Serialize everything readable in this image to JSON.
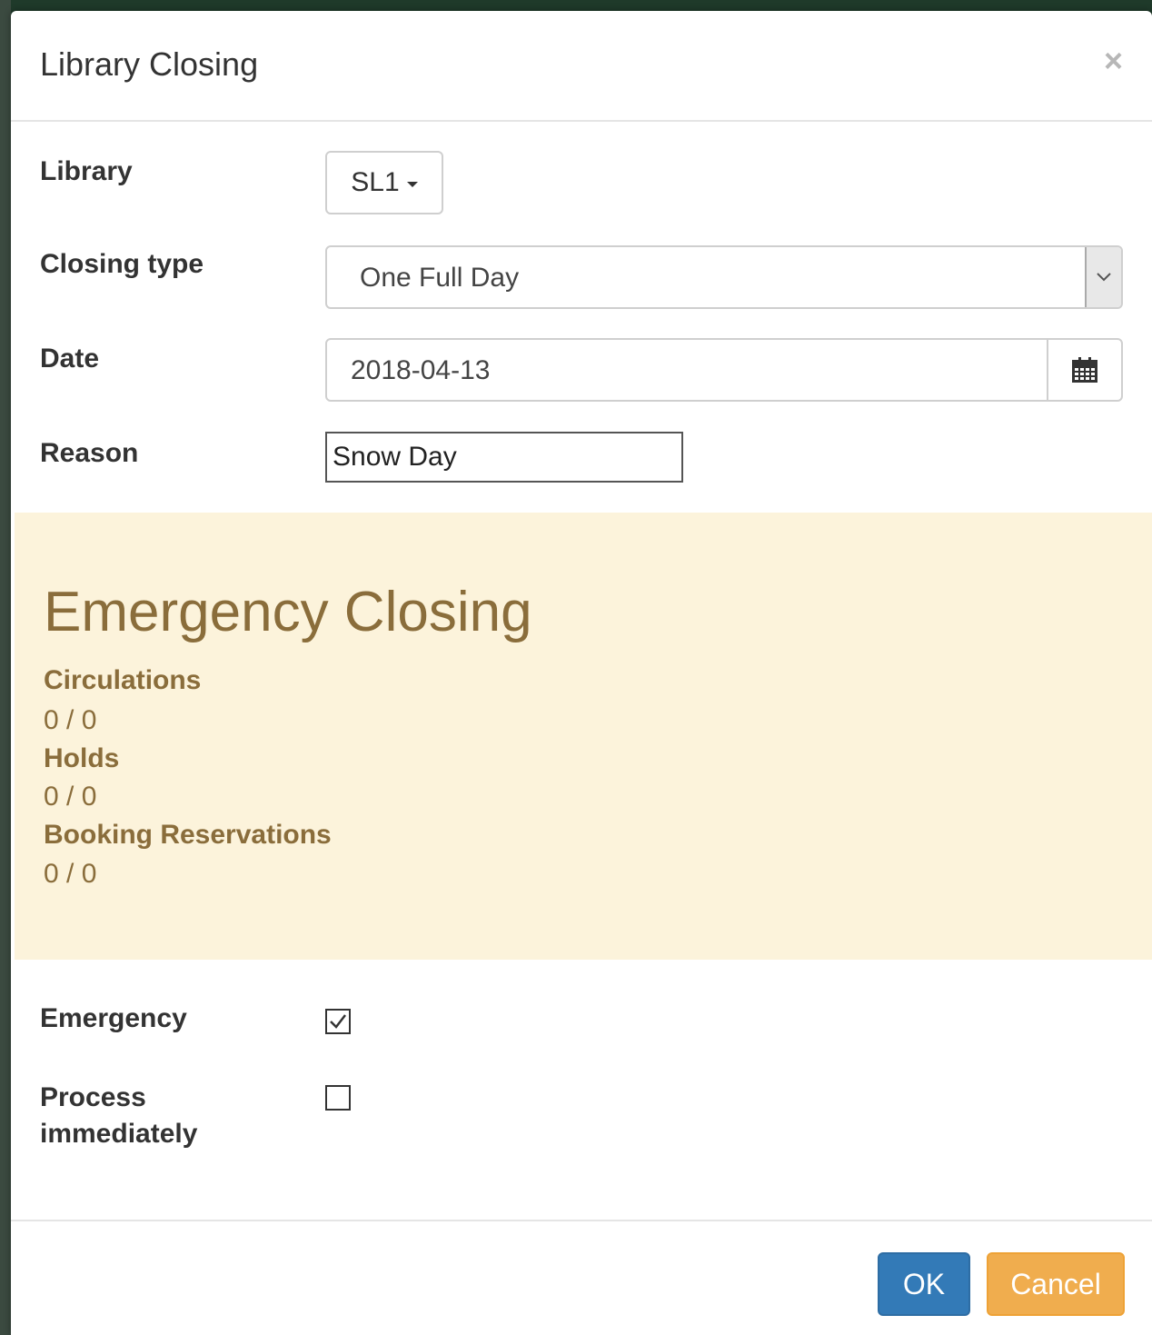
{
  "dialog": {
    "title": "Library Closing",
    "close_symbol": "×"
  },
  "form": {
    "library_label": "Library",
    "library_value": "SL1",
    "closing_type_label": "Closing type",
    "closing_type_value": "One Full Day",
    "date_label": "Date",
    "date_value": "2018-04-13",
    "reason_label": "Reason",
    "reason_value": "Snow Day"
  },
  "alert": {
    "title": "Emergency Closing",
    "circulations_label": "Circulations",
    "circulations_value": "0 / 0",
    "holds_label": "Holds",
    "holds_value": "0 / 0",
    "bookings_label": "Booking Reservations",
    "bookings_value": "0 / 0"
  },
  "options": {
    "emergency_label": "Emergency",
    "emergency_checked": true,
    "process_label_line1": "Process",
    "process_label_line2": "immediately",
    "process_checked": false
  },
  "footer": {
    "ok_label": "OK",
    "cancel_label": "Cancel"
  },
  "colors": {
    "ok": "#337ab7",
    "cancel": "#f0ad4e",
    "alert_bg": "#fcf3db",
    "alert_text": "#8a6d3b"
  },
  "icons": {
    "calendar": "calendar-icon",
    "select_arrow": "chevron-down-icon",
    "close": "close-icon"
  }
}
